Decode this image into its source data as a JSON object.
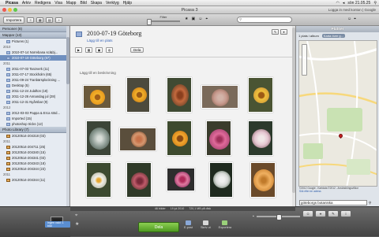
{
  "menubar": {
    "app": "Picasa",
    "items": [
      "Arkiv",
      "Redigera",
      "Visa",
      "Mapp",
      "Bild",
      "Skapa",
      "Verktyg",
      "Hjälp"
    ],
    "clock": "sön 21.05.25"
  },
  "window": {
    "title": "Picasa 3",
    "login": "Logga in med konton | Google"
  },
  "toolbar": {
    "import_label": "Importera",
    "filter_label": "Filter",
    "search_placeholder": ""
  },
  "sidebar": {
    "sections": [
      {
        "label": "Personer (8)"
      },
      {
        "label": "Mappar (13)"
      }
    ],
    "top_items": [
      "Pictures (1)"
    ],
    "year_2010": "2010",
    "items_2010": [
      "2010-07-14 Norrebana scl&bj...",
      "2010-07-19 Göteborg (67)"
    ],
    "year_2011": "2011",
    "items_2011": [
      "2011-07-03 Tanzverk (11)",
      "2011-07-17 Stockholm (65)",
      "2011-09-24 Tranbärsplockning ...",
      "Desktop (5)",
      "2011-12-24 Julafton (18)",
      "2011-12-26 Annandag jul (28)",
      "2011-12-31 Nyårsbar (9)"
    ],
    "year_2012": "2012",
    "items_2012": [
      "2012-03-03 Pappa & Erca stöd...",
      "Imported (15)",
      "photoshop tricks (12)"
    ],
    "library_label": "Photo Library (7)",
    "lib_item_1": "20120514-204318 (03)",
    "year_2011b": "2011",
    "items_lib": [
      "20120514-204711 (25)",
      "20120514-204340 (15)",
      "20120514-204341 (03)",
      "20120514-204343 (18)",
      "20120514-204344 (23)"
    ],
    "year_2011c": "2011",
    "items_lib2": [
      "20120514-204344 (11)"
    ]
  },
  "album": {
    "title": "2010-07-19 Göteborg",
    "place": "Lägg till en plats",
    "share_label": "Dela",
    "description": "Lägg till en beskrivning"
  },
  "status_bar": {
    "selected": "46 bilder",
    "date": "19 jul 2010",
    "size": "720,1 MB på disk"
  },
  "places": {
    "header": "Platser",
    "count": "1 plats i album",
    "tag": "Karta över g...",
    "attribution": "©2012 Google - Kartdata ©2012 - Användningsvillkor",
    "link": "Sök efter en adress",
    "search_value": "göteborgs botaniska"
  },
  "tray": {
    "thumb_label": "Ingen vald: 1 bild",
    "share_label": "Dela",
    "actions": [
      "E-post",
      "Skriv ut",
      "Exportera"
    ]
  },
  "colors": {
    "accent": "#6f8fbf",
    "share_green": "#5aa82c"
  }
}
